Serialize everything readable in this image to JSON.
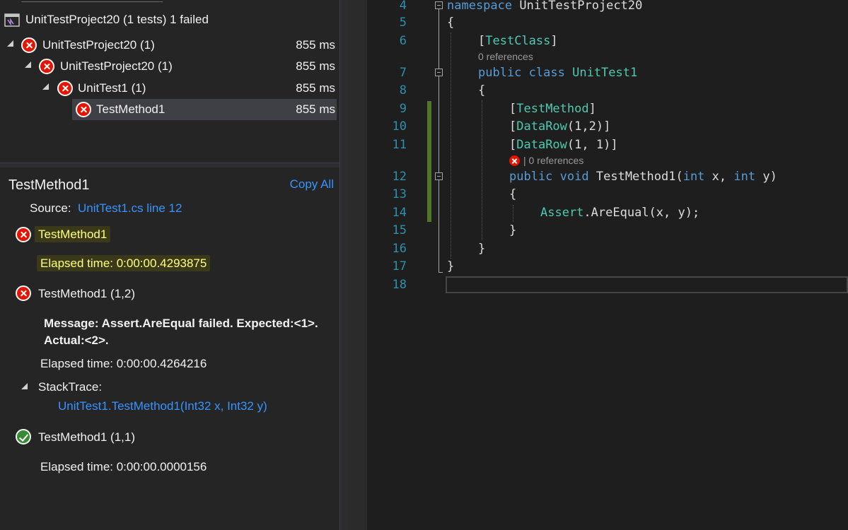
{
  "explorer": {
    "header": "UnitTestProject20 (1 tests) 1 failed",
    "tree": [
      {
        "label": "UnitTestProject20 (1)",
        "duration": "855 ms"
      },
      {
        "label": "UnitTestProject20 (1)",
        "duration": "855 ms"
      },
      {
        "label": "UnitTest1 (1)",
        "duration": "855 ms"
      },
      {
        "label": "TestMethod1",
        "duration": "855 ms"
      }
    ]
  },
  "detail": {
    "title": "TestMethod1",
    "copy_all": "Copy All",
    "source_label": "Source:",
    "source_link": "UnitTest1.cs line 12",
    "main_result": {
      "name": "TestMethod1",
      "elapsed": "Elapsed time: 0:00:00.4293875"
    },
    "case1": {
      "name": "TestMethod1 (1,2)",
      "message_line1": "Message: Assert.AreEqual failed. Expected:<1>.",
      "message_line2": "Actual:<2>.",
      "elapsed": "Elapsed time: 0:00:00.4264216",
      "stacktrace_label": "StackTrace:",
      "stacktrace_link": "UnitTest1.TestMethod1(Int32 x, Int32 y)"
    },
    "case2": {
      "name": "TestMethod1 (1,1)",
      "elapsed": "Elapsed time: 0:00:00.0000156"
    }
  },
  "editor": {
    "line_numbers": [
      "4",
      "5",
      "6",
      "7",
      "8",
      "9",
      "10",
      "11",
      "12",
      "13",
      "14",
      "15",
      "16",
      "17",
      "18"
    ],
    "l4": {
      "kw": "namespace",
      "name": " UnitTestProject20"
    },
    "l5": "{",
    "l6": {
      "open": "[",
      "attr": "TestClass",
      "close": "]"
    },
    "ref6": "0 references",
    "l7": {
      "kw1": "public",
      "kw2": "class",
      "name": "UnitTest1"
    },
    "l8": "{",
    "l9": {
      "open": "[",
      "attr": "TestMethod",
      "close": "]"
    },
    "l10": {
      "open": "[",
      "attr": "DataRow",
      "args": "(1,2)]"
    },
    "l11": {
      "open": "[",
      "attr": "DataRow",
      "args": "(1, 1)]"
    },
    "ref12": "| 0 references",
    "l12": {
      "kw1": "public",
      "kw2": "void",
      "name": "TestMethod1(",
      "kw3": "int",
      "p1": " x, ",
      "kw4": "int",
      "p2": " y)"
    },
    "l13": "{",
    "l14": {
      "cls": "Assert",
      "rest": ".AreEqual(x, y);"
    },
    "l15": "}",
    "l16": "}",
    "l17": "}"
  }
}
